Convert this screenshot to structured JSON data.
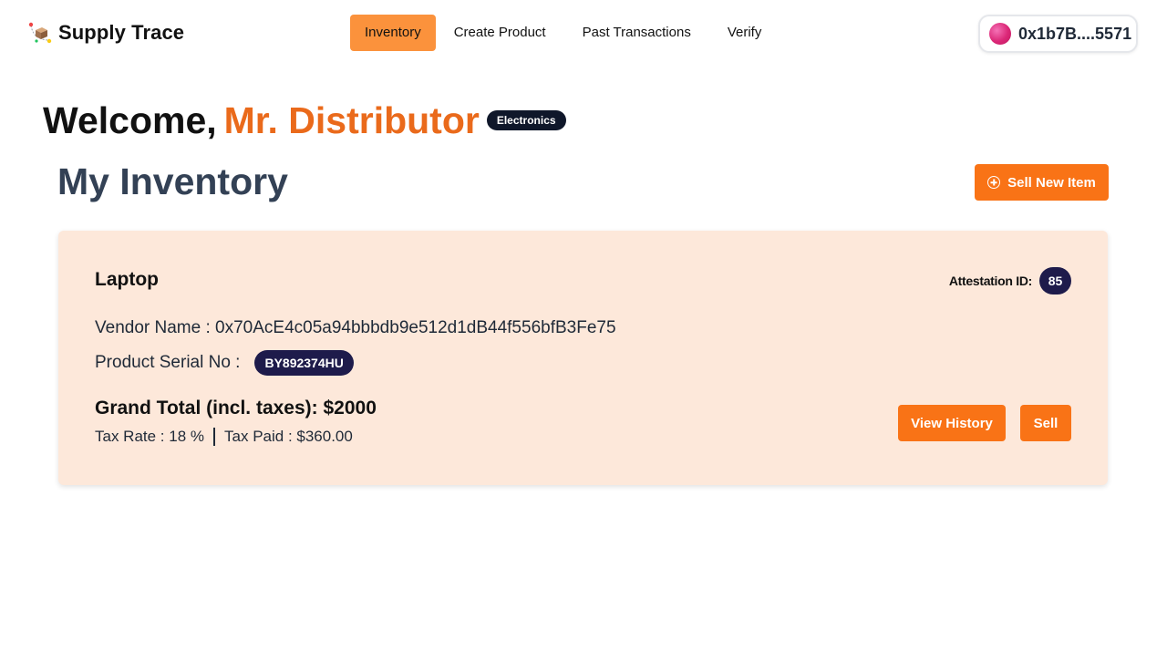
{
  "header": {
    "brand": "Supply Trace",
    "nav": [
      {
        "label": "Inventory",
        "active": true
      },
      {
        "label": "Create Product",
        "active": false
      },
      {
        "label": "Past Transactions",
        "active": false
      },
      {
        "label": "Verify",
        "active": false
      }
    ],
    "wallet_address": "0x1b7B....5571"
  },
  "welcome": {
    "prefix": "Welcome,",
    "name": "Mr. Distributor",
    "category": "Electronics"
  },
  "inventory": {
    "title": "My Inventory",
    "sell_new_label": "Sell New Item",
    "items": [
      {
        "name": "Laptop",
        "attestation_label": "Attestation ID:",
        "attestation_id": "85",
        "vendor_label": "Vendor Name :",
        "vendor": "0x70AcE4c05a94bbbdb9e512d1dB44f556bfB3Fe75",
        "serial_label": "Product Serial No :",
        "serial": "BY892374HU",
        "grand_total": "Grand Total (incl. taxes): $2000",
        "tax_rate": "Tax Rate : 18 %",
        "tax_paid": "Tax Paid : $360.00",
        "view_history_label": "View History",
        "sell_label": "Sell"
      }
    ]
  },
  "colors": {
    "accent": "#f97316",
    "nav_active": "#fb923c",
    "name_highlight": "#ea6a1b",
    "card_bg": "#fde8da",
    "badge_dark": "#1e1b4b"
  },
  "icons": {
    "brand": "supply-box-logo-icon",
    "sell_new": "plus-circle-icon",
    "wallet": "wallet-avatar-icon"
  }
}
